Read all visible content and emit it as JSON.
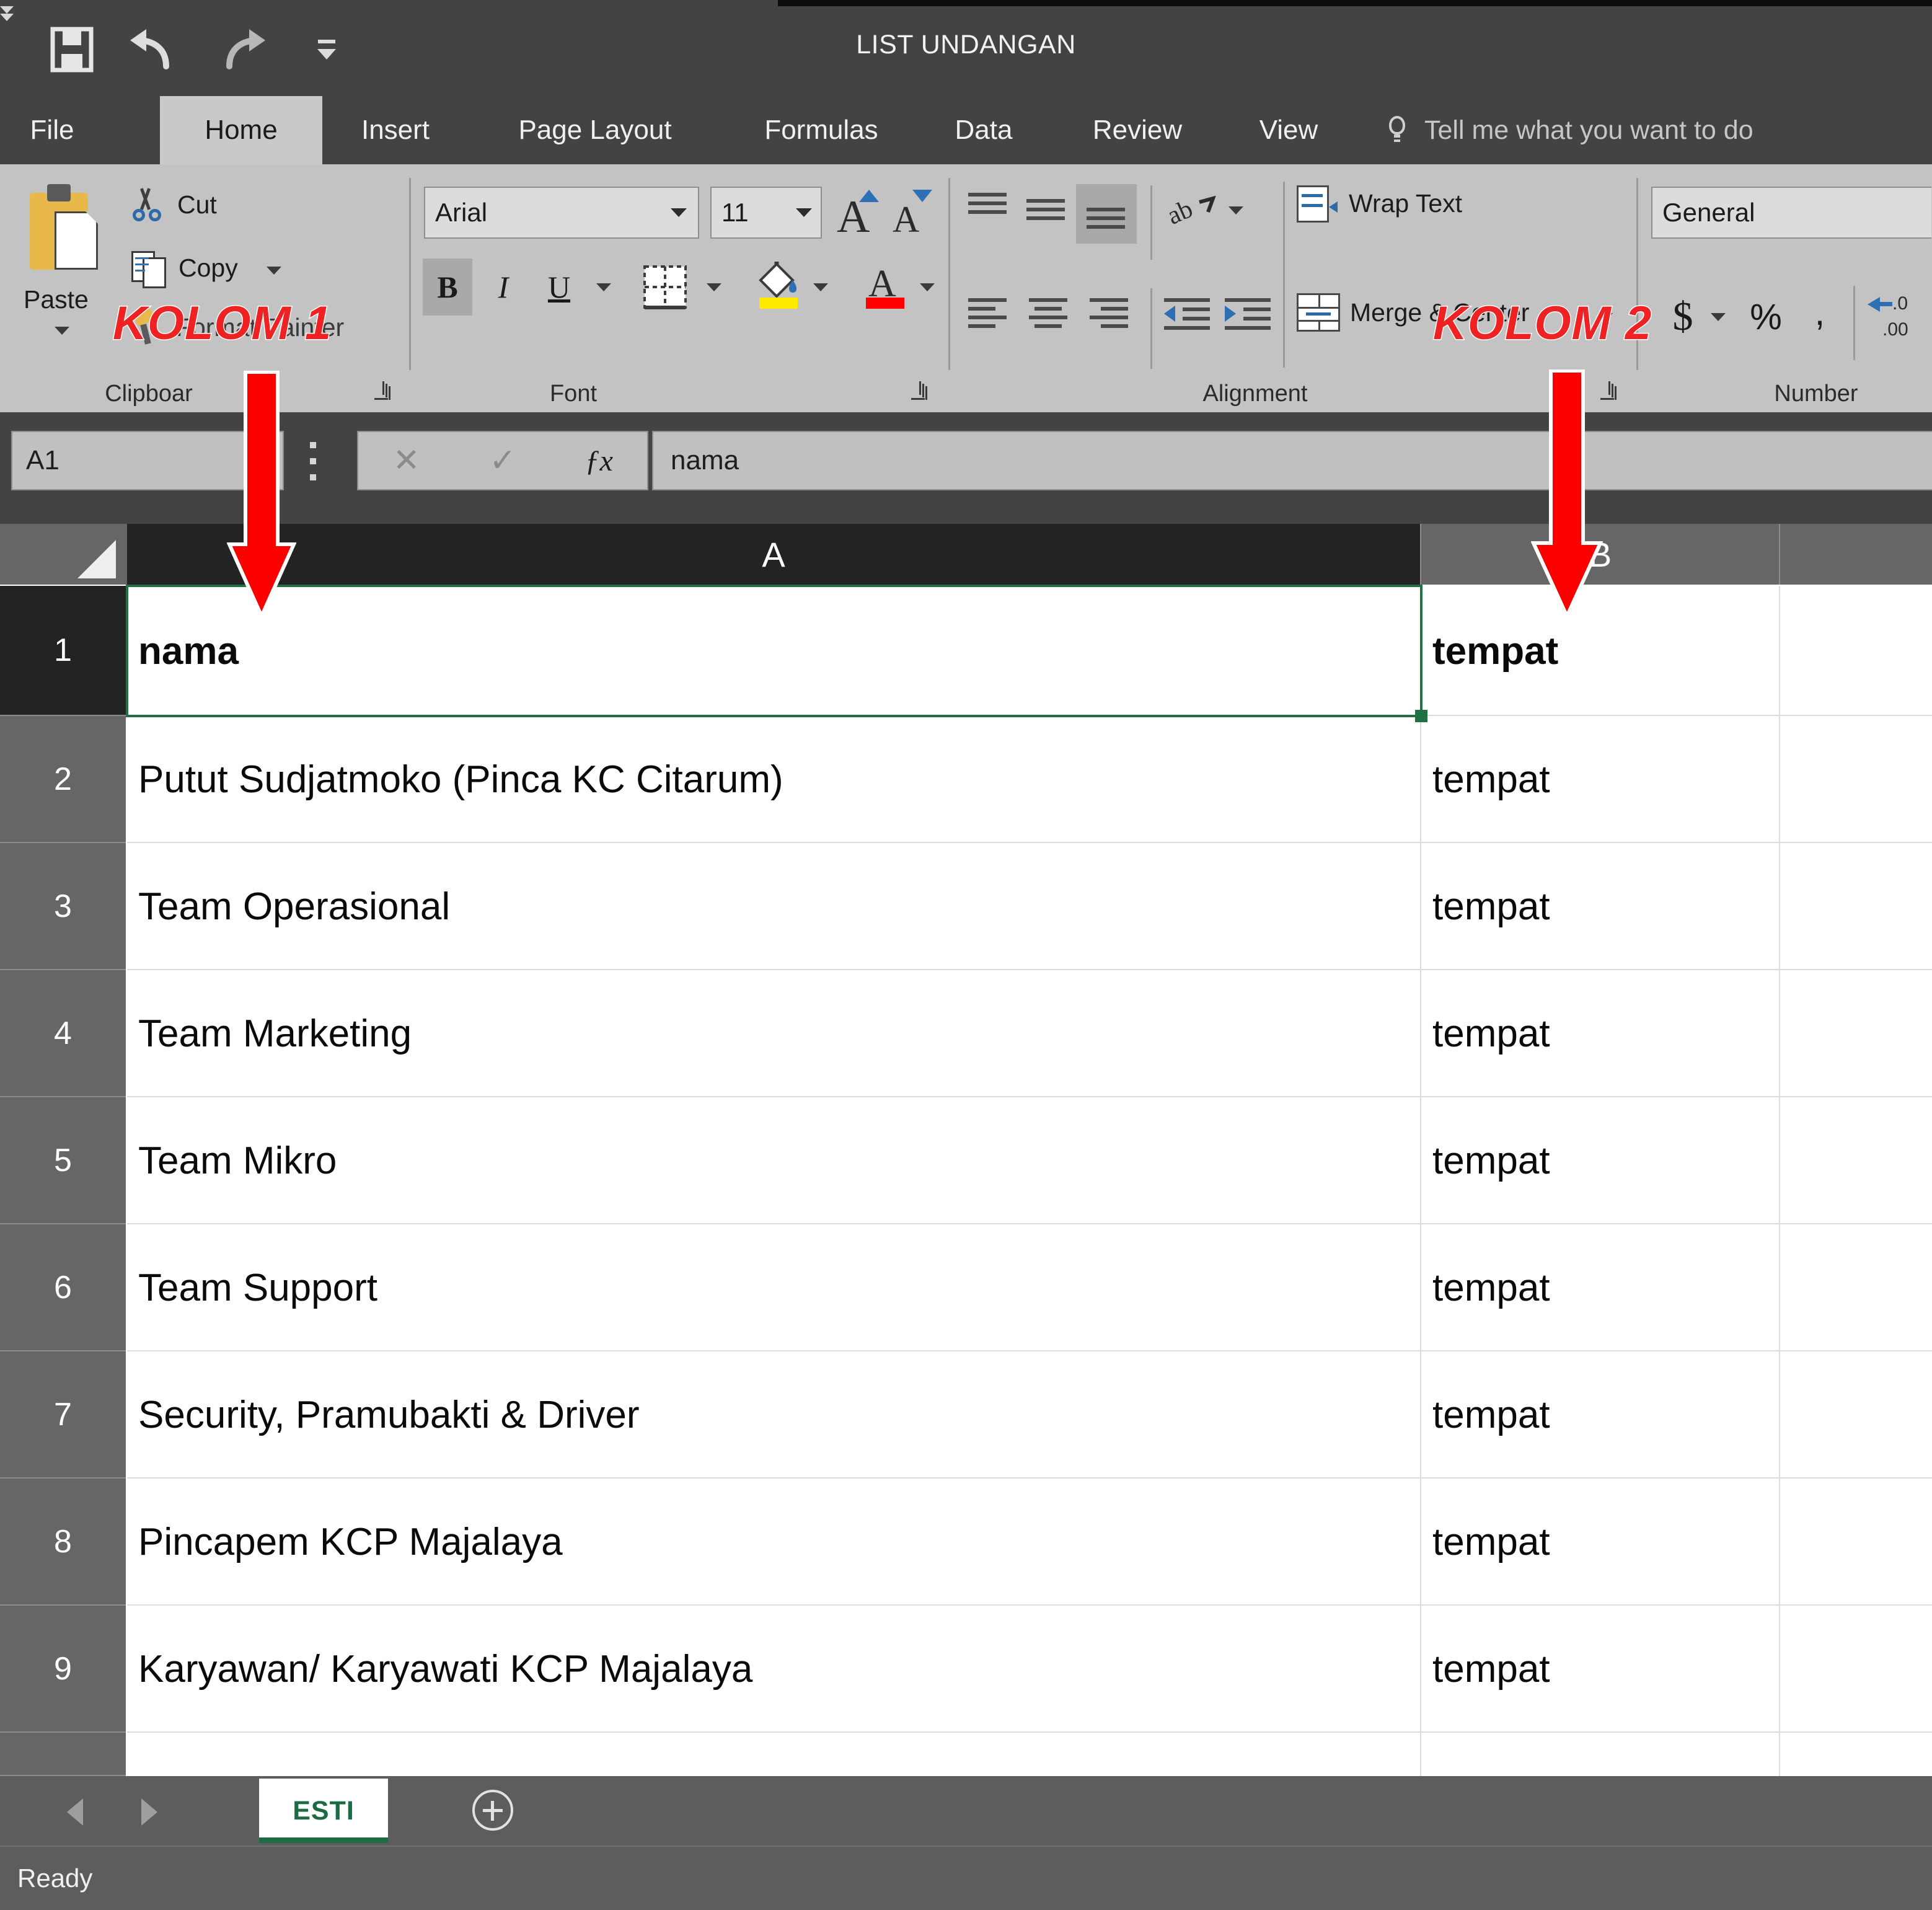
{
  "window": {
    "title": "LIST UNDANGAN"
  },
  "quick_access": {
    "items": [
      {
        "name": "save-icon",
        "label": "Save"
      },
      {
        "name": "undo-icon",
        "label": "Undo"
      },
      {
        "name": "redo-icon",
        "label": "Redo"
      },
      {
        "name": "customize-qat-icon",
        "label": "Customize Quick Access Toolbar"
      }
    ]
  },
  "ribbon": {
    "tabs": [
      {
        "label": "File",
        "active": false
      },
      {
        "label": "Home",
        "active": true
      },
      {
        "label": "Insert",
        "active": false
      },
      {
        "label": "Page Layout",
        "active": false
      },
      {
        "label": "Formulas",
        "active": false
      },
      {
        "label": "Data",
        "active": false
      },
      {
        "label": "Review",
        "active": false
      },
      {
        "label": "View",
        "active": false
      }
    ],
    "tell_me": "Tell me what you want to do",
    "groups": {
      "clipboard": {
        "label": "Clipboar",
        "paste": "Paste",
        "cut": "Cut",
        "copy": "Copy",
        "format_painter": "Format Painter"
      },
      "font": {
        "label": "Font",
        "font_name": "Arial",
        "font_size": "11",
        "bold": "B",
        "italic": "I",
        "underline": "U"
      },
      "alignment": {
        "label": "Alignment",
        "wrap_text": "Wrap Text",
        "merge_center": "Merge & Center"
      },
      "number": {
        "label": "Number",
        "format": "General",
        "currency": "$",
        "percent": "%",
        "comma": ","
      }
    }
  },
  "formula_bar": {
    "name_box": "A1",
    "cancel": "✕",
    "enter": "✓",
    "insert_function": "ƒx",
    "content": "nama"
  },
  "sheet": {
    "columns": [
      {
        "id": "A",
        "label": "A",
        "selected": true
      },
      {
        "id": "B",
        "label": "B",
        "selected": false
      },
      {
        "id": "C",
        "label": "",
        "selected": false
      }
    ],
    "rows": [
      "1",
      "2",
      "3",
      "4",
      "5",
      "6",
      "7",
      "8",
      "9"
    ],
    "selected_cell": "A1",
    "data": [
      {
        "row": "1",
        "A": "nama",
        "B": "tempat",
        "bold": true
      },
      {
        "row": "2",
        "A": "Putut Sudjatmoko (Pinca KC Citarum)",
        "B": "tempat",
        "bold": false
      },
      {
        "row": "3",
        "A": "Team Operasional",
        "B": "tempat",
        "bold": false
      },
      {
        "row": "4",
        "A": "Team Marketing",
        "B": "tempat",
        "bold": false
      },
      {
        "row": "5",
        "A": "Team Mikro",
        "B": "tempat",
        "bold": false
      },
      {
        "row": "6",
        "A": "Team Support",
        "B": "tempat",
        "bold": false
      },
      {
        "row": "7",
        "A": "Security, Pramubakti & Driver",
        "B": "tempat",
        "bold": false
      },
      {
        "row": "8",
        "A": "Pincapem KCP Majalaya",
        "B": "tempat",
        "bold": false
      },
      {
        "row": "9",
        "A": "Karyawan/ Karyawati KCP Majalaya",
        "B": "tempat",
        "bold": false
      }
    ]
  },
  "sheet_tabs": {
    "active": "ESTI",
    "add_label": "+"
  },
  "status_bar": {
    "text": "Ready"
  },
  "annotations": [
    {
      "name": "kolom-1-annotation",
      "text": "KOLOM 1",
      "color": "#ee2222"
    },
    {
      "name": "kolom-2-annotation",
      "text": "KOLOM 2",
      "color": "#ee2222"
    }
  ],
  "colors": {
    "accent_green": "#207245",
    "annotation_red": "#fc0000",
    "chrome_dark": "#434343",
    "ribbon_gray": "#c3c3c3"
  }
}
